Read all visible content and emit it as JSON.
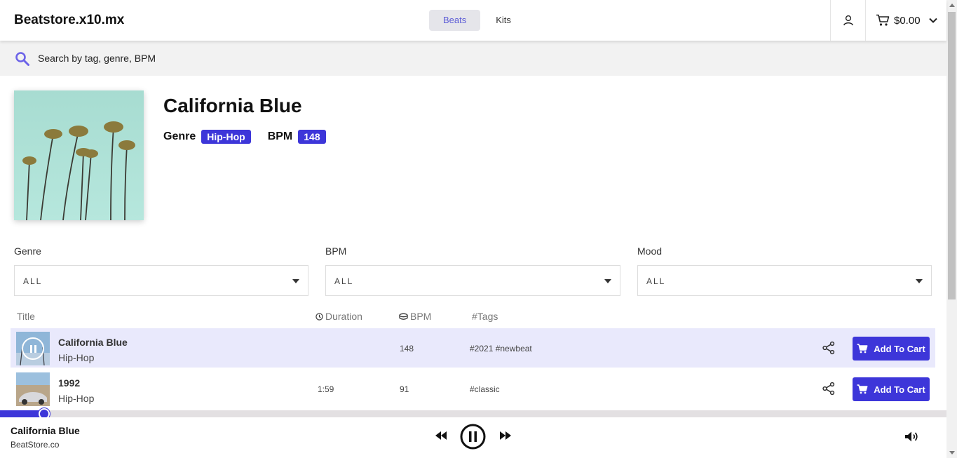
{
  "header": {
    "logo": "Beatstore.x10.mx",
    "nav": [
      {
        "label": "Beats",
        "active": true
      },
      {
        "label": "Kits",
        "active": false
      }
    ],
    "cart_total": "$0.00"
  },
  "search": {
    "placeholder": "Search by tag, genre, BPM"
  },
  "beat": {
    "title": "California Blue",
    "genre_label": "Genre",
    "genre": "Hip-Hop",
    "bpm_label": "BPM",
    "bpm": "148"
  },
  "filters": [
    {
      "label": "Genre",
      "value": "ALL"
    },
    {
      "label": "BPM",
      "value": "ALL"
    },
    {
      "label": "Mood",
      "value": "ALL"
    }
  ],
  "table": {
    "headers": {
      "title": "Title",
      "duration": "Duration",
      "bpm": "BPM",
      "tags": "#Tags"
    },
    "rows": [
      {
        "name": "California Blue",
        "genre": "Hip-Hop",
        "duration": "",
        "bpm": "148",
        "tags": "#2021 #newbeat",
        "playing": true,
        "button": "Add To Cart"
      },
      {
        "name": "1992",
        "genre": "Hip-Hop",
        "duration": "1:59",
        "bpm": "91",
        "tags": "#classic",
        "playing": false,
        "button": "Add To Cart"
      }
    ]
  },
  "player": {
    "title": "California Blue",
    "artist": "BeatStore.co",
    "progress": 0.047
  },
  "colors": {
    "accent": "#3d36d9",
    "active_row": "#e9e9fc",
    "search_bg": "#f2f2f2"
  }
}
